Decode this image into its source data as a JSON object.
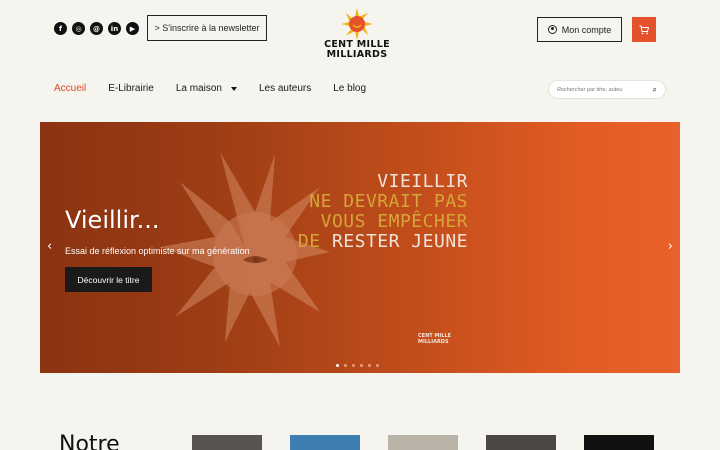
{
  "social": {
    "icons": [
      "facebook-icon",
      "instagram-icon",
      "threads-icon",
      "linkedin-icon",
      "youtube-icon"
    ]
  },
  "header": {
    "newsletter_label": "> S'inscrire à la newsletter",
    "logo_line1": "CENT MILLE",
    "logo_line2": "MILLIARDS",
    "account_label": "Mon compte",
    "cart_icon": "cart-icon"
  },
  "nav": {
    "items": [
      {
        "label": "Accueil",
        "active": true
      },
      {
        "label": "E-Librairie"
      },
      {
        "label": "La maison",
        "dropdown": true
      },
      {
        "label": "Les auteurs"
      },
      {
        "label": "Le blog"
      }
    ]
  },
  "search": {
    "placeholder": "Rechercher par titre, auteu"
  },
  "hero": {
    "title": "Vieillir...",
    "subtitle": "Essai de réflexion optimiste sur ma génération",
    "button": "Découvrir le titre",
    "cover_line1": "VIEILLIR",
    "cover_line2": "NE DEVRAIT PAS",
    "cover_line3": "VOUS EMPÊCHER",
    "cover_line4a": "DE",
    "cover_line4b": "RESTER JEUNE",
    "cover_mark1": "CENT MILLE",
    "cover_mark2": "MILLIARDS",
    "slides": 6,
    "active_slide": 0
  },
  "section": {
    "title": "Notre"
  },
  "colors": {
    "accent": "#e5512a",
    "background": "#f6f4ef"
  }
}
